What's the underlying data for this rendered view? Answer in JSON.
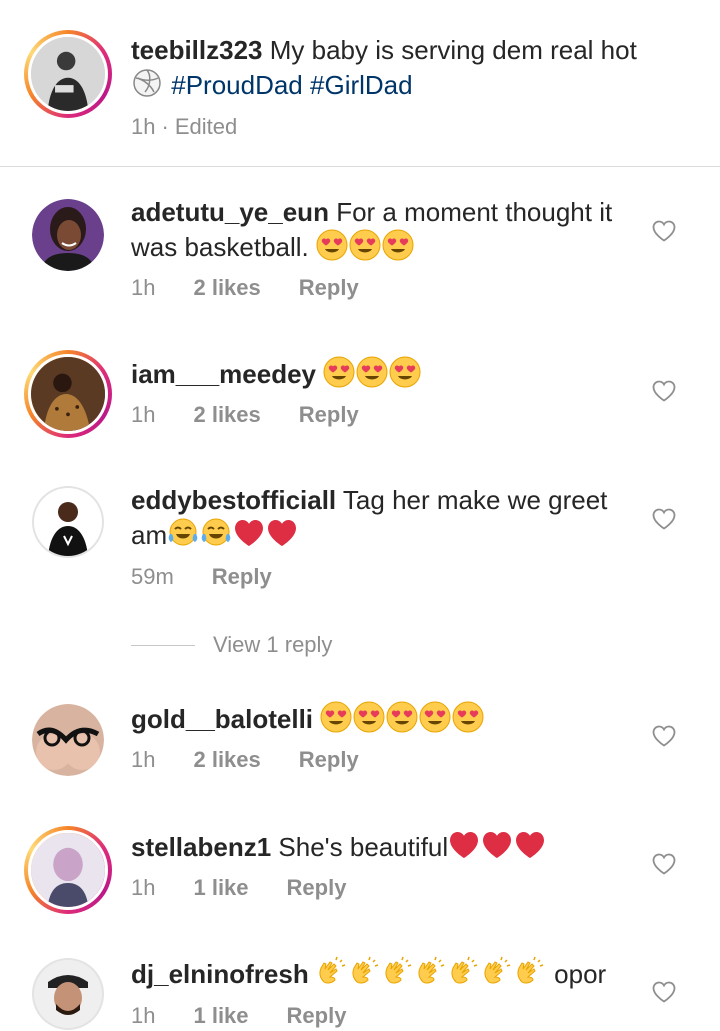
{
  "post": {
    "username": "teebillz323",
    "caption": "My baby is serving dem real hot",
    "hashtags": [
      "#ProudDad",
      "#GirlDad"
    ],
    "time": "1h",
    "separator": "·",
    "edited": "Edited"
  },
  "comments": [
    {
      "username": "adetutu_ye_eun",
      "text": "For a moment thought it was basketball.",
      "emojis": [
        "heart-eyes",
        "heart-eyes",
        "heart-eyes"
      ],
      "time": "1h",
      "likes": "2 likes",
      "reply": "Reply"
    },
    {
      "username": "iam___meedey",
      "text": "",
      "emojis": [
        "heart-eyes",
        "heart-eyes",
        "heart-eyes"
      ],
      "time": "1h",
      "likes": "2 likes",
      "reply": "Reply"
    },
    {
      "username": "eddybestofficiall",
      "text": "Tag her make we greet am",
      "emojis": [
        "tears-of-joy",
        "tears-of-joy",
        "red-heart",
        "red-heart"
      ],
      "time": "59m",
      "likes": "",
      "reply": "Reply"
    },
    {
      "username": "gold__balotelli",
      "text": "",
      "emojis": [
        "heart-eyes",
        "heart-eyes",
        "heart-eyes",
        "heart-eyes",
        "heart-eyes"
      ],
      "time": "1h",
      "likes": "2 likes",
      "reply": "Reply"
    },
    {
      "username": "stellabenz1",
      "text": "She's beautiful",
      "emojis": [
        "red-heart",
        "red-heart",
        "red-heart"
      ],
      "time": "1h",
      "likes": "1 like",
      "reply": "Reply"
    },
    {
      "username": "dj_elninofresh",
      "text": "opor",
      "emojis": [
        "clapping-hands",
        "clapping-hands",
        "clapping-hands",
        "clapping-hands",
        "clapping-hands",
        "clapping-hands",
        "clapping-hands"
      ],
      "time": "1h",
      "likes": "1 like",
      "reply": "Reply"
    }
  ],
  "view_replies": "View 1 reply",
  "icons": {
    "like": "heart-outline-icon",
    "post_emoji": "volleyball-icon"
  },
  "colors": {
    "meta": "#8e8e8e",
    "hashtag": "#003569",
    "divider": "#dbdbdb"
  }
}
